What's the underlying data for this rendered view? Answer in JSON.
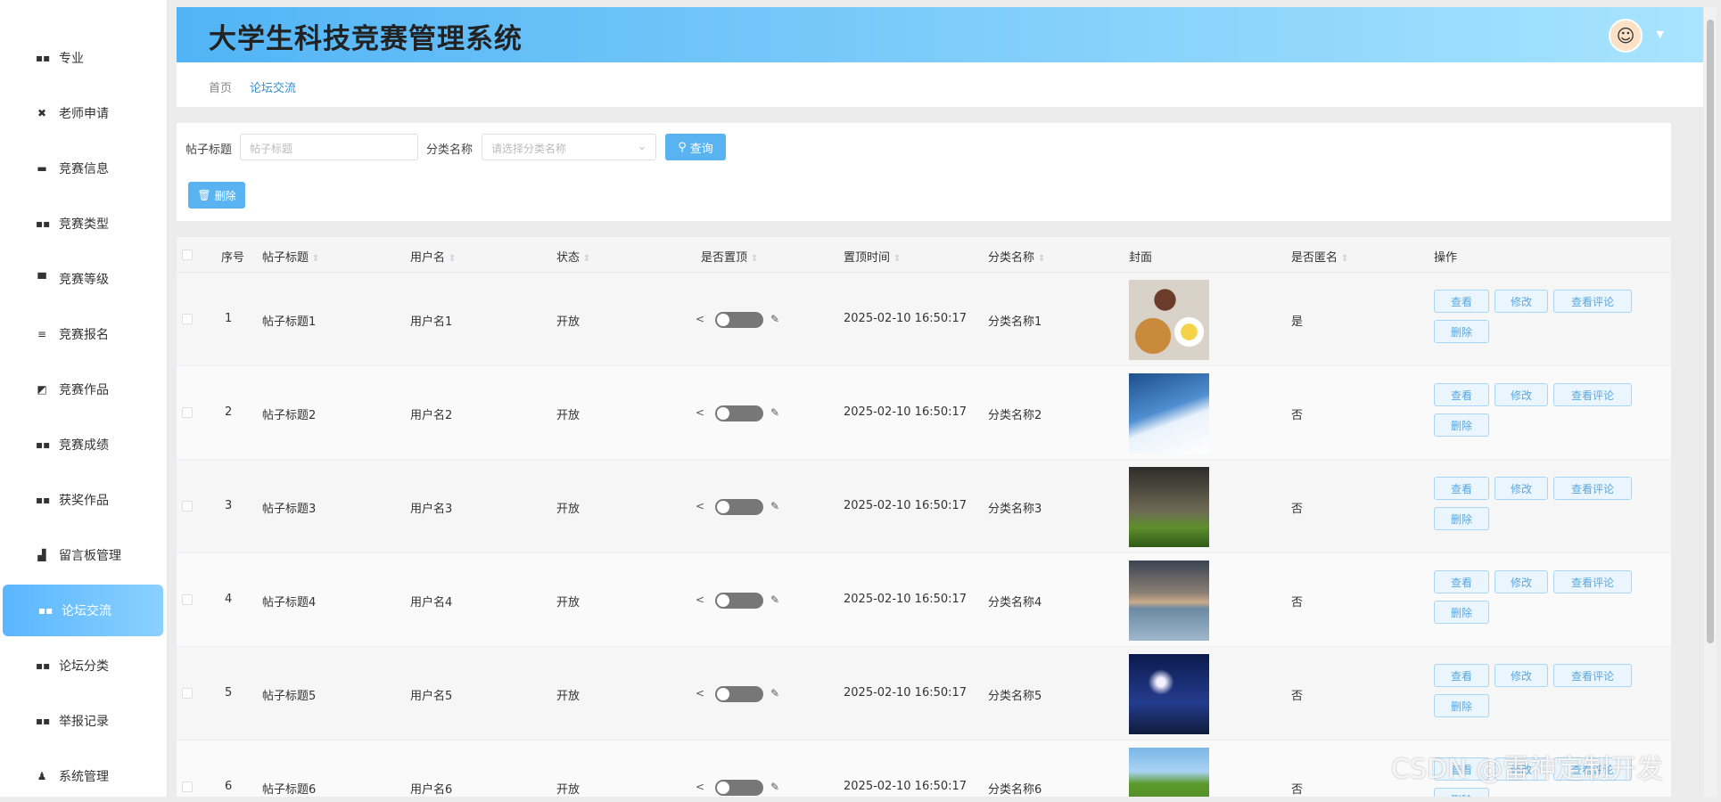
{
  "app": {
    "title": "大学生科技竞赛管理系统"
  },
  "sidebar": {
    "items": [
      {
        "label": "专业",
        "icon": "grid-icon",
        "active": false
      },
      {
        "label": "老师申请",
        "icon": "cross-icon",
        "active": false
      },
      {
        "label": "竞赛信息",
        "icon": "monitor-icon",
        "active": false
      },
      {
        "label": "竞赛类型",
        "icon": "grid-icon",
        "active": false
      },
      {
        "label": "竞赛等级",
        "icon": "print-icon",
        "active": false
      },
      {
        "label": "竞赛报名",
        "icon": "list-icon",
        "active": false
      },
      {
        "label": "竞赛作品",
        "icon": "chart-icon",
        "active": false
      },
      {
        "label": "竞赛成绩",
        "icon": "grid-icon",
        "active": false
      },
      {
        "label": "获奖作品",
        "icon": "grid-icon",
        "active": false
      },
      {
        "label": "留言板管理",
        "icon": "thumb-icon",
        "active": false
      },
      {
        "label": "论坛交流",
        "icon": "grid-icon",
        "active": true
      },
      {
        "label": "论坛分类",
        "icon": "grid-icon",
        "active": false
      },
      {
        "label": "举报记录",
        "icon": "grid-icon",
        "active": false
      },
      {
        "label": "系统管理",
        "icon": "user-icon",
        "active": false
      }
    ]
  },
  "breadcrumb": {
    "home": "首页",
    "current": "论坛交流"
  },
  "filter": {
    "title_label": "帖子标题",
    "title_placeholder": "帖子标题",
    "category_label": "分类名称",
    "category_placeholder": "请选择分类名称",
    "query_label": "查询",
    "delete_label": "删除"
  },
  "table": {
    "headers": {
      "index": "序号",
      "title": "帖子标题",
      "username": "用户名",
      "status": "状态",
      "pinned": "是否置顶",
      "pin_time": "置顶时间",
      "category": "分类名称",
      "cover": "封面",
      "anonymous": "是否匿名",
      "actions": "操作"
    },
    "action_labels": {
      "view": "查看",
      "edit": "修改",
      "comments": "查看评论",
      "delete": "删除"
    },
    "rows": [
      {
        "index": "1",
        "title": "帖子标题1",
        "username": "用户名1",
        "status": "开放",
        "pin_time": "2025-02-10 16:50:17",
        "category": "分类名称1",
        "anonymous": "是",
        "cover": "food-photo"
      },
      {
        "index": "2",
        "title": "帖子标题2",
        "username": "用户名2",
        "status": "开放",
        "pin_time": "2025-02-10 16:50:17",
        "category": "分类名称2",
        "anonymous": "否",
        "cover": "ski-photo"
      },
      {
        "index": "3",
        "title": "帖子标题3",
        "username": "用户名3",
        "status": "开放",
        "pin_time": "2025-02-10 16:50:17",
        "category": "分类名称3",
        "anonymous": "否",
        "cover": "soccer-photo"
      },
      {
        "index": "4",
        "title": "帖子标题4",
        "username": "用户名4",
        "status": "开放",
        "pin_time": "2025-02-10 16:50:17",
        "category": "分类名称4",
        "anonymous": "否",
        "cover": "lake-photo"
      },
      {
        "index": "5",
        "title": "帖子标题5",
        "username": "用户名5",
        "status": "开放",
        "pin_time": "2025-02-10 16:50:17",
        "category": "分类名称5",
        "anonymous": "否",
        "cover": "night-photo"
      },
      {
        "index": "6",
        "title": "帖子标题6",
        "username": "用户名6",
        "status": "开放",
        "pin_time": "2025-02-10 16:50:17",
        "category": "分类名称6",
        "anonymous": "否",
        "cover": "meadow-photo"
      }
    ]
  },
  "colors": {
    "accent": "#59b3f0",
    "sidebar_active": "#6cc2ff",
    "topbar_start": "#52b4f5",
    "topbar_end": "#a8e4ff"
  },
  "watermark": "CSDN @雷神定制开发"
}
